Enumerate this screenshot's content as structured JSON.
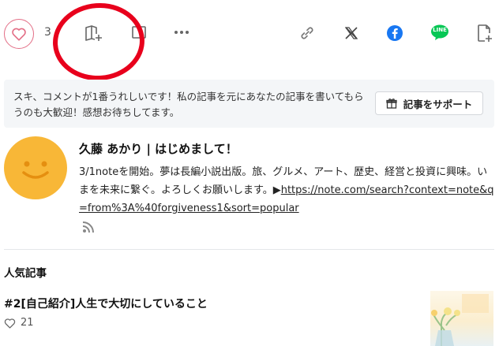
{
  "toolbar": {
    "like_count": "3",
    "like_icon": "heart-outline-icon",
    "magazine_icon": "magazine-add-icon",
    "bookmark_icon": "bookmark-icon",
    "more_icon": "more-horizontal-icon",
    "share_icons": [
      "link-icon",
      "x-icon",
      "facebook-icon",
      "line-icon",
      "embed-add-icon"
    ],
    "line_label": "LINE"
  },
  "support": {
    "message": "スキ、コメントが1番うれしいです！私の記事を元にあなたの記事を書いてもらうのも大歓迎！感想お待ちしてます。",
    "button_label": "記事をサポート"
  },
  "author": {
    "name": "久藤 あかり | はじめまして！",
    "bio_text": "3/1noteを開始。夢は長編小説出版。旅、グルメ、アート、歴史、経営と投資に興味。いまを未来に繋ぐ。よろしくお願いします。▶",
    "bio_link": "https://note.com/search?context=note&q=from%3A%40forgiveness1&sort=popular"
  },
  "popular": {
    "heading": "人気記事",
    "articles": [
      {
        "title": "#2[自己紹介]人生で大切にしていること",
        "likes": "21"
      }
    ]
  },
  "colors": {
    "like_border": "#e36e86",
    "annotation_red": "#e8001c",
    "facebook_blue": "#1877f2",
    "line_green": "#06c755",
    "avatar_yellow": "#f8b737"
  }
}
